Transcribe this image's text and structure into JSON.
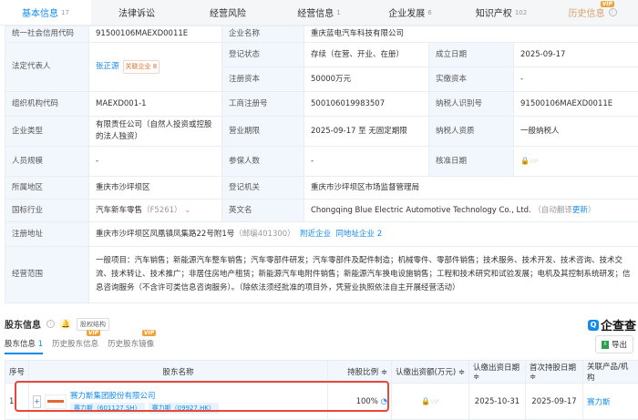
{
  "tabs": [
    {
      "label": "基本信息",
      "count": "17"
    },
    {
      "label": "法律诉讼",
      "count": ""
    },
    {
      "label": "经营风险",
      "count": ""
    },
    {
      "label": "经营信息",
      "count": "1"
    },
    {
      "label": "企业发展",
      "count": "6"
    },
    {
      "label": "知识产权",
      "count": "102"
    },
    {
      "label": "历史信息",
      "count": "",
      "badge": "VIP"
    }
  ],
  "info": {
    "credit_code_label": "统一社会信用代码",
    "credit_code": "91500106MAEXD0011E",
    "name_label": "企业名称",
    "name": "重庆蓝电汽车科技有限公司",
    "legal_rep_label": "法定代表人",
    "legal_rep": "张正源",
    "related_tag": "关联企业 8",
    "status_label": "登记状态",
    "status": "存续（在营、开业、在册）",
    "founded_label": "成立日期",
    "founded": "2025-09-17",
    "capital_label": "注册资本",
    "capital": "50000万元",
    "paid_label": "实缴资本",
    "paid": "-",
    "org_code_label": "组织机构代码",
    "org_code": "MAEXD001-1",
    "reg_no_label": "工商注册号",
    "reg_no": "500106019983507",
    "tax_id_label": "纳税人识别号",
    "tax_id": "91500106MAEXD0011E",
    "type_label": "企业类型",
    "type": "有限责任公司（自然人投资或控股的法人独资）",
    "term_label": "营业期限",
    "term": "2025-09-17 至 无固定期限",
    "taxpayer_label": "纳税人资质",
    "taxpayer": "一般纳税人",
    "staff_label": "人员规模",
    "staff": "-",
    "insured_label": "参保人数",
    "insured": "-",
    "approve_label": "核准日期",
    "approve_badge": "VIP",
    "region_label": "所属地区",
    "region": "重庆市沙坪坝区",
    "authority_label": "登记机关",
    "authority": "重庆市沙坪坝区市场监督管理局",
    "industry_label": "国标行业",
    "industry": "汽车新车零售",
    "industry_code": "（F5261）",
    "en_label": "英文名",
    "en_name": "Chongqing Blue Electric Automotive Technology Co., Ltd.",
    "auto_translate": "（自动翻译",
    "update": "更新",
    "close_paren": "）",
    "address_label": "注册地址",
    "address": "重庆市沙坪坝区凤凰镇凤集路22号附1号",
    "postcode": "（邮编401300）",
    "nearby": "附近企业",
    "same_addr": "同地址企业 2",
    "scope_label": "经营范围",
    "scope": "一般项目：汽车销售；新能源汽车整车销售；汽车零部件研发；汽车零部件及配件制造；机械零件、零部件销售；技术服务、技术开发、技术咨询、技术交流、技术转让、技术推广；非居住房地产租赁；新能源汽车电附件销售；新能源汽车换电设施销售；工程和技术研究和试验发展；电机及其控制系统研发；信息咨询服务（不含许可类信息咨询服务）。（除依法须经批准的项目外，凭营业执照依法自主开展经营活动）"
  },
  "shareholders": {
    "title": "股东信息",
    "equity_btn": "股权结构",
    "logo": "企查查",
    "subtabs": [
      {
        "label": "股东信息",
        "count": "1"
      },
      {
        "label": "历史股东信息",
        "badge": "VIP"
      },
      {
        "label": "历史股东镜像",
        "badge": "VIP"
      }
    ],
    "export": "导出",
    "columns": [
      "序号",
      "股东名称",
      "持股比例 ≑",
      "认缴出资额(万元) ≑",
      "认缴出资日期 ≑",
      "首次持股日期 ≑",
      "关联产品/机构"
    ],
    "rows": [
      {
        "index": "1",
        "name": "赛力斯集团股份有限公司",
        "stock1": "赛力斯（601127.SH）",
        "stock2": "赛力斯（09927.HK）",
        "ratio": "100%",
        "amount_badge": "VIP",
        "sub_date": "2025-10-31",
        "first_date": "2025-09-17",
        "product": "赛力斯"
      }
    ]
  }
}
